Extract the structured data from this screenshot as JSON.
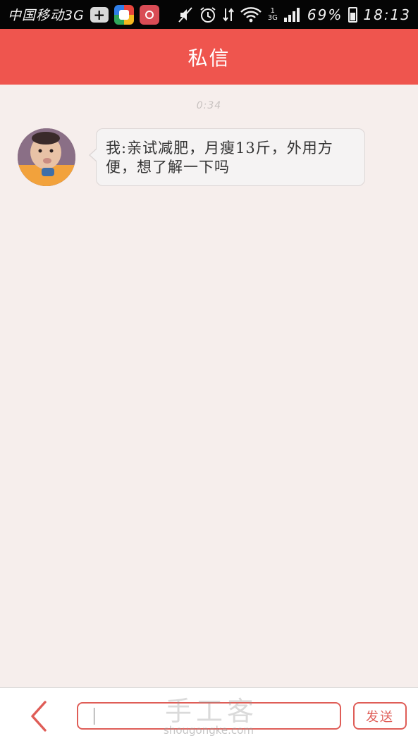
{
  "status_bar": {
    "carrier": "中国移动3G",
    "icons": [
      "plus-icon",
      "app-icon",
      "app-icon",
      "mute-icon",
      "alarm-icon",
      "data-transfer-icon",
      "wifi-icon",
      "signal-icon",
      "battery-icon"
    ],
    "sim_label": "1",
    "network_label": "3G",
    "battery_percent": "69%",
    "time": "18:13"
  },
  "header": {
    "title": "私信"
  },
  "chat": {
    "timestamp": "0:34",
    "messages": [
      {
        "avatar": "baby-photo-avatar",
        "text": "我:亲试减肥，月瘦13斤，外用方便，想了解一下吗"
      }
    ]
  },
  "input_bar": {
    "input_value": "",
    "send_label": "发送",
    "back_icon": "chevron-left-icon"
  },
  "watermark": {
    "logo_text": "手工客",
    "domain": "shougongke.com"
  },
  "colors": {
    "header_bg": "#ef554e",
    "accent": "#df5d57",
    "chat_bg": "#f6eeec",
    "bubble_bg": "#f5f3f3"
  }
}
